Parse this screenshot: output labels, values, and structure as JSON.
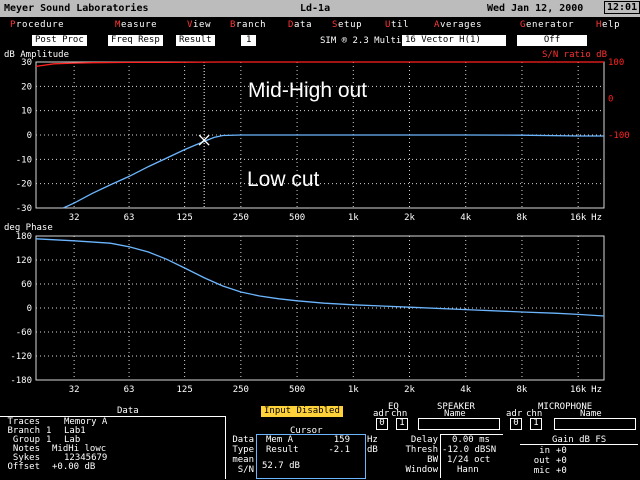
{
  "app": {
    "title": "Meyer Sound Laboratories",
    "document": "Ld-1a",
    "date": "Wed Jan 12, 2000",
    "time": "12:01"
  },
  "menu": [
    {
      "hot": "P",
      "rest": "rocedure"
    },
    {
      "hot": "M",
      "rest": "easure"
    },
    {
      "hot": "V",
      "rest": "iew"
    },
    {
      "hot": "B",
      "rest": "ranch"
    },
    {
      "hot": "D",
      "rest": "ata"
    },
    {
      "hot": "S",
      "rest": "etup"
    },
    {
      "hot": "U",
      "rest": "til"
    },
    {
      "hot": "A",
      "rest": "verages"
    },
    {
      "hot": "G",
      "rest": "enerator"
    },
    {
      "hot": "H",
      "rest": "elp"
    }
  ],
  "toolbar": {
    "post_proc": "Post Proc",
    "freq_resp": "Freq Resp",
    "result": "Result",
    "channel": "1",
    "sim": "SIM ® 2.3 Multi",
    "vector": "16  Vector H(1)",
    "off": "Off"
  },
  "amplitude_plot": {
    "label": "dB Amplitude",
    "sn_label": "S/N ratio dB",
    "annotation_top": "Mid-High out",
    "annotation_bottom": "Low cut",
    "y_ticks": [
      "30",
      "20",
      "10",
      "0",
      "-10",
      "-20",
      "-30"
    ],
    "sn_ticks": [
      "100",
      "0",
      "-100"
    ],
    "x_ticks": [
      "32",
      "63",
      "125",
      "250",
      "500",
      "1k",
      "2k",
      "4k",
      "8k",
      "16k",
      "Hz"
    ]
  },
  "phase_plot": {
    "label": "deg Phase",
    "y_ticks": [
      "180",
      "120",
      "60",
      "0",
      "-60",
      "-120",
      "-180"
    ],
    "x_ticks": [
      "32",
      "63",
      "125",
      "250",
      "500",
      "1k",
      "2k",
      "4k",
      "8k",
      "16k",
      "Hz"
    ]
  },
  "colors": {
    "trace": "#6cb6ff",
    "sn_trace": "#ff2020",
    "grid": "#d8d8d8",
    "menu_hotkey": "#ff3838",
    "warning": "#ffd23a"
  },
  "chart_data": [
    {
      "type": "line",
      "title": "dB Amplitude",
      "x_scale": "log",
      "xlabel": "Hz",
      "ylabel": "dB Amplitude",
      "xlim": [
        20,
        22000
      ],
      "ylim": [
        -30,
        30
      ],
      "series": [
        {
          "name": "",
          "color": "#6cb6ff",
          "x": [
            28,
            32,
            40,
            50,
            63,
            80,
            100,
            125,
            160,
            180,
            200,
            250,
            300,
            500,
            1000,
            2000,
            4000,
            8000,
            16000,
            22000
          ],
          "y": [
            -30,
            -28,
            -24,
            -20.5,
            -17,
            -13,
            -9.5,
            -6,
            -2.5,
            -1.0,
            -0.2,
            0,
            0,
            0,
            0,
            0,
            0,
            -0.1,
            -0.4,
            -0.4
          ]
        },
        {
          "name": "",
          "color": "#ff2020",
          "axis": "S/N ratio dB",
          "x": [
            20,
            25,
            32,
            40,
            63,
            100,
            200,
            500,
            1000,
            4000,
            16000,
            22000
          ],
          "y": [
            88,
            95,
            97,
            98,
            99,
            99,
            100,
            100,
            100,
            100,
            100,
            100
          ]
        }
      ]
    },
    {
      "type": "line",
      "title": "deg Phase",
      "x_scale": "log",
      "xlabel": "Hz",
      "ylabel": "deg Phase",
      "xlim": [
        20,
        22000
      ],
      "ylim": [
        -180,
        180
      ],
      "series": [
        {
          "name": "",
          "color": "#6cb6ff",
          "x": [
            20,
            32,
            50,
            63,
            80,
            100,
            125,
            160,
            200,
            250,
            315,
            400,
            500,
            700,
            1000,
            2000,
            4000,
            8000,
            12000,
            16000,
            22000
          ],
          "y": [
            173,
            168,
            162,
            153,
            140,
            122,
            100,
            75,
            55,
            40,
            30,
            23,
            18,
            12,
            8,
            2,
            -4,
            -10,
            -13,
            -16,
            -20
          ]
        }
      ]
    }
  ],
  "bottom": {
    "data_header": "Data",
    "traces_label": "Traces",
    "traces_value": "Memory A",
    "branch_label": "Branch",
    "branch_num": "1",
    "branch_value": "Lab1",
    "group_label": "Group",
    "group_num": "1",
    "group_value": "Lab",
    "notes_label": "Notes",
    "notes_value": "MidHi lowc",
    "sykes_label": "Sykes",
    "sykes_value": "12345679",
    "offset_label": "Offset",
    "offset_value": "+0.00 dB",
    "input_disabled": "Input Disabled",
    "cursor_header": "Cursor",
    "cursor_data_label": "Data",
    "cursor_type_label": "Type",
    "cursor_mean_label": "mean",
    "cursor_sn_label": "S/N",
    "cursor_data_value": "Mem A",
    "cursor_freq": "159",
    "cursor_freq_unit": "Hz",
    "cursor_type_value": "Result",
    "cursor_db": "-2.1",
    "cursor_db_unit": "dB",
    "cursor_sn_value": "52.7 dB",
    "eq_header": "EQ",
    "eq_adr": "adr",
    "eq_chn": "chn",
    "eq_adr_value": "0",
    "eq_chn_value": "1",
    "speaker_header": "SPEAKER",
    "speaker_name": "Name",
    "mic_header": "MICROPHONE",
    "mic_adr": "adr",
    "mic_chn": "chn",
    "mic_name": "Name",
    "mic_adr_value": "0",
    "mic_chn_value": "1",
    "delay_label": "Delay",
    "delay_value": "0.00 ms",
    "thresh_label": "Thresh",
    "thresh_value": "-12.0 dBSN",
    "bw_label": "BW",
    "bw_value": "1/24 oct",
    "window_label": "Window",
    "window_value": "Hann",
    "gain_header": "Gain dB FS",
    "gain_in_label": "in",
    "gain_in_value": "+0",
    "gain_out_label": "out",
    "gain_out_value": "+0",
    "gain_mic_label": "mic",
    "gain_mic_value": "+0"
  }
}
